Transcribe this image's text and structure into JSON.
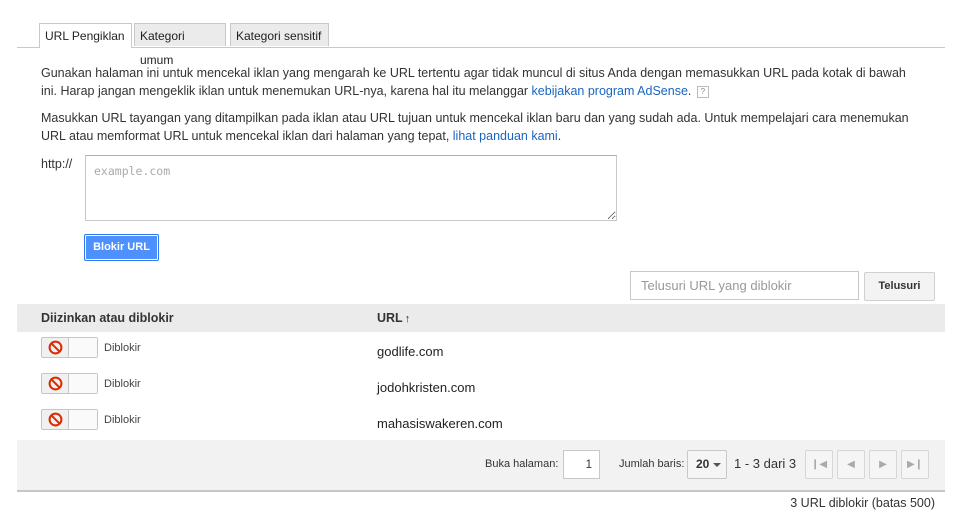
{
  "tabs": [
    {
      "label": "URL Pengiklan"
    },
    {
      "label": "Kategori umum"
    },
    {
      "label": "Kategori sensitif"
    }
  ],
  "intro": {
    "para1_text": "Gunakan halaman ini untuk mencekal iklan yang mengarah ke URL tertentu agar tidak muncul di situs Anda dengan memasukkan URL pada kotak di bawah ini. Harap jangan mengeklik iklan untuk menemukan URL-nya, karena hal itu melanggar ",
    "para1_link": "kebijakan program AdSense",
    "para1_end": ".",
    "help_glyph": "?",
    "para2_text": "Masukkan URL tayangan yang ditampilkan pada iklan atau URL tujuan untuk mencekal iklan baru dan yang sudah ada. Untuk mempelajari cara menemukan URL atau memformat URL untuk mencekal iklan dari halaman yang tepat, ",
    "para2_link": "lihat panduan kami",
    "para2_end": "."
  },
  "form": {
    "prefix": "http://",
    "placeholder": "example.com",
    "block_button": "Blokir URL"
  },
  "search": {
    "placeholder": "Telusuri URL yang diblokir",
    "button": "Telusuri"
  },
  "table": {
    "col_status": "Diizinkan atau diblokir",
    "col_url": "URL",
    "sort_icon": "arrow-up-icon",
    "rows": [
      {
        "status": "Diblokir",
        "url": "godlife.com"
      },
      {
        "status": "Diblokir",
        "url": "jodohkristen.com"
      },
      {
        "status": "Diblokir",
        "url": "mahasiswakeren.com"
      }
    ]
  },
  "pagination": {
    "goto_label": "Buka halaman:",
    "page_value": "1",
    "rows_label": "Jumlah baris:",
    "rows_value": "20",
    "range": "1 - 3 dari 3"
  },
  "footer": {
    "count": "3 URL diblokir (batas 500)"
  },
  "colors": {
    "primary_button": "#4d90fe",
    "link": "#1a65c0",
    "block_icon": "#dd2c00"
  }
}
